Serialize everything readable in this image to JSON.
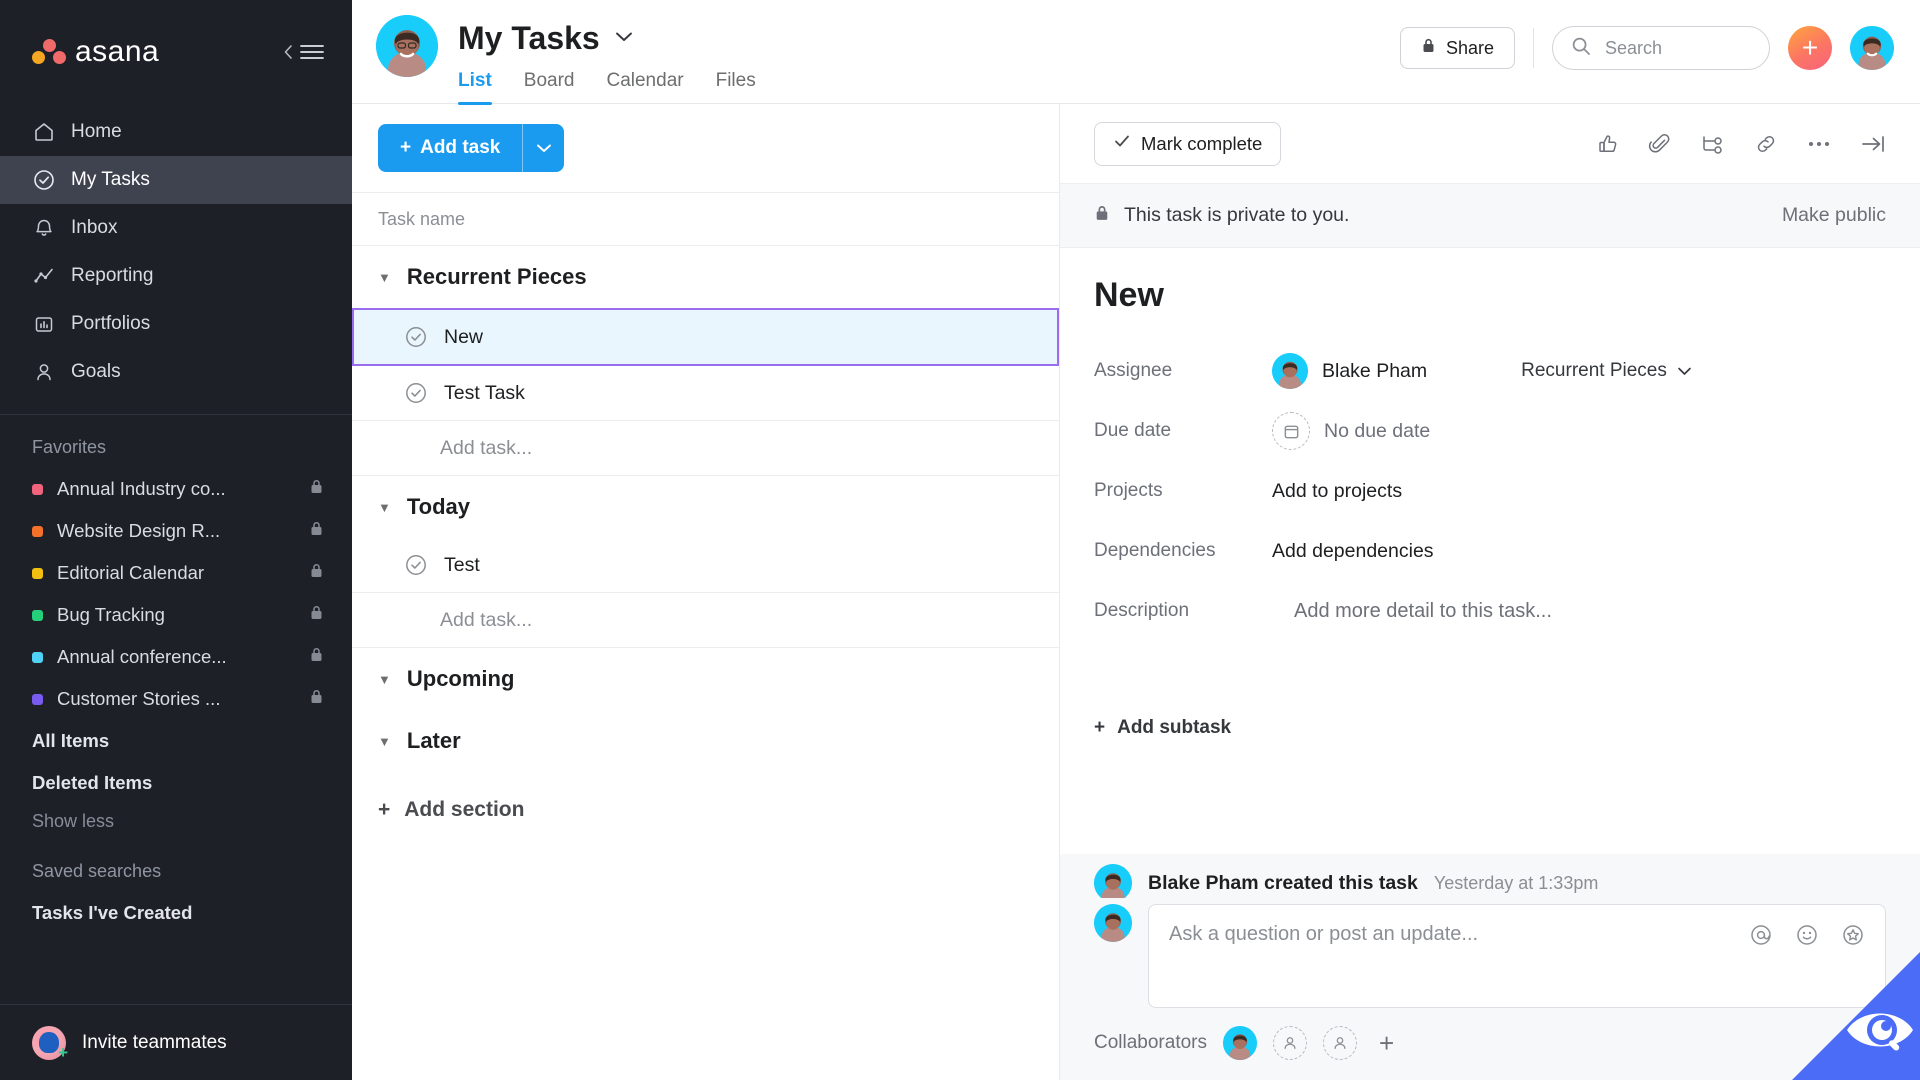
{
  "sidebar": {
    "brand": "asana",
    "collapse_icon": "collapse-sidebar-icon",
    "nav": [
      {
        "label": "Home",
        "icon": "home-icon",
        "active": false
      },
      {
        "label": "My Tasks",
        "icon": "check-circle-icon",
        "active": true
      },
      {
        "label": "Inbox",
        "icon": "bell-icon",
        "active": false
      },
      {
        "label": "Reporting",
        "icon": "chart-line-icon",
        "active": false
      },
      {
        "label": "Portfolios",
        "icon": "portfolio-icon",
        "active": false
      },
      {
        "label": "Goals",
        "icon": "goal-person-icon",
        "active": false
      }
    ],
    "favorites_label": "Favorites",
    "favorites": [
      {
        "label": "Annual Industry co...",
        "color": "#f0657d",
        "locked": true
      },
      {
        "label": "Website Design R...",
        "color": "#f4712a",
        "locked": true
      },
      {
        "label": "Editorial Calendar",
        "color": "#f3c011",
        "locked": true
      },
      {
        "label": "Bug Tracking",
        "color": "#25d07a",
        "locked": true
      },
      {
        "label": "Annual conference...",
        "color": "#4fd2f5",
        "locked": true
      },
      {
        "label": "Customer Stories ...",
        "color": "#7a5bf0",
        "locked": true
      }
    ],
    "all_items": "All Items",
    "deleted_items": "Deleted Items",
    "show_less": "Show less",
    "saved_searches_label": "Saved searches",
    "saved_searches": [
      "Tasks I've Created"
    ],
    "invite": "Invite teammates"
  },
  "header": {
    "title": "My Tasks",
    "title_caret": "chevron-down-icon",
    "tabs": [
      {
        "label": "List",
        "active": true
      },
      {
        "label": "Board",
        "active": false
      },
      {
        "label": "Calendar",
        "active": false
      },
      {
        "label": "Files",
        "active": false
      }
    ],
    "share_label": "Share",
    "search_placeholder": "Search",
    "plus_label": "+"
  },
  "list": {
    "add_task_label": "Add task",
    "column_header": "Task name",
    "sections": [
      {
        "name": "Recurrent Pieces",
        "tasks": [
          {
            "name": "New",
            "selected": true
          },
          {
            "name": "Test Task",
            "selected": false
          }
        ],
        "add_task_ghost": "Add task..."
      },
      {
        "name": "Today",
        "tasks": [
          {
            "name": "Test",
            "selected": false
          }
        ],
        "add_task_ghost": "Add task..."
      },
      {
        "name": "Upcoming",
        "tasks": [],
        "add_task_ghost": ""
      },
      {
        "name": "Later",
        "tasks": [],
        "add_task_ghost": ""
      }
    ],
    "add_section_label": "Add section"
  },
  "detail": {
    "mark_complete_label": "Mark complete",
    "toolbar_icons": [
      "thumbs-up-icon",
      "paperclip-icon",
      "subtask-icon",
      "link-icon",
      "ellipsis-icon",
      "collapse-panel-icon"
    ],
    "privacy_text": "This task is private to you.",
    "make_public_label": "Make public",
    "task_title": "New",
    "fields": {
      "assignee_label": "Assignee",
      "assignee_value": "Blake Pham",
      "project_chip": "Recurrent Pieces",
      "due_date_label": "Due date",
      "due_date_value": "No due date",
      "projects_label": "Projects",
      "projects_value": "Add to projects",
      "dependencies_label": "Dependencies",
      "dependencies_value": "Add dependencies",
      "description_label": "Description",
      "description_placeholder": "Add more detail to this task..."
    },
    "add_subtask_label": "Add subtask",
    "activity_text": "Blake Pham created this task",
    "activity_time": "Yesterday at 1:33pm",
    "comment_placeholder": "Ask a question or post an update...",
    "comment_icons": [
      "mention-icon",
      "emoji-icon",
      "sticker-icon"
    ],
    "collaborators_label": "Collaborators",
    "collaborators_add": "+",
    "bell_icon": "bell-icon"
  },
  "colors": {
    "sidebar_bg": "#1e2028",
    "accent_blue": "#1b9bf0",
    "selection_purple": "#9a6cf0",
    "selection_fill": "#eaf6fd",
    "avatar_bg": "#19cdfb",
    "corner_blue": "#4a6cf7"
  }
}
